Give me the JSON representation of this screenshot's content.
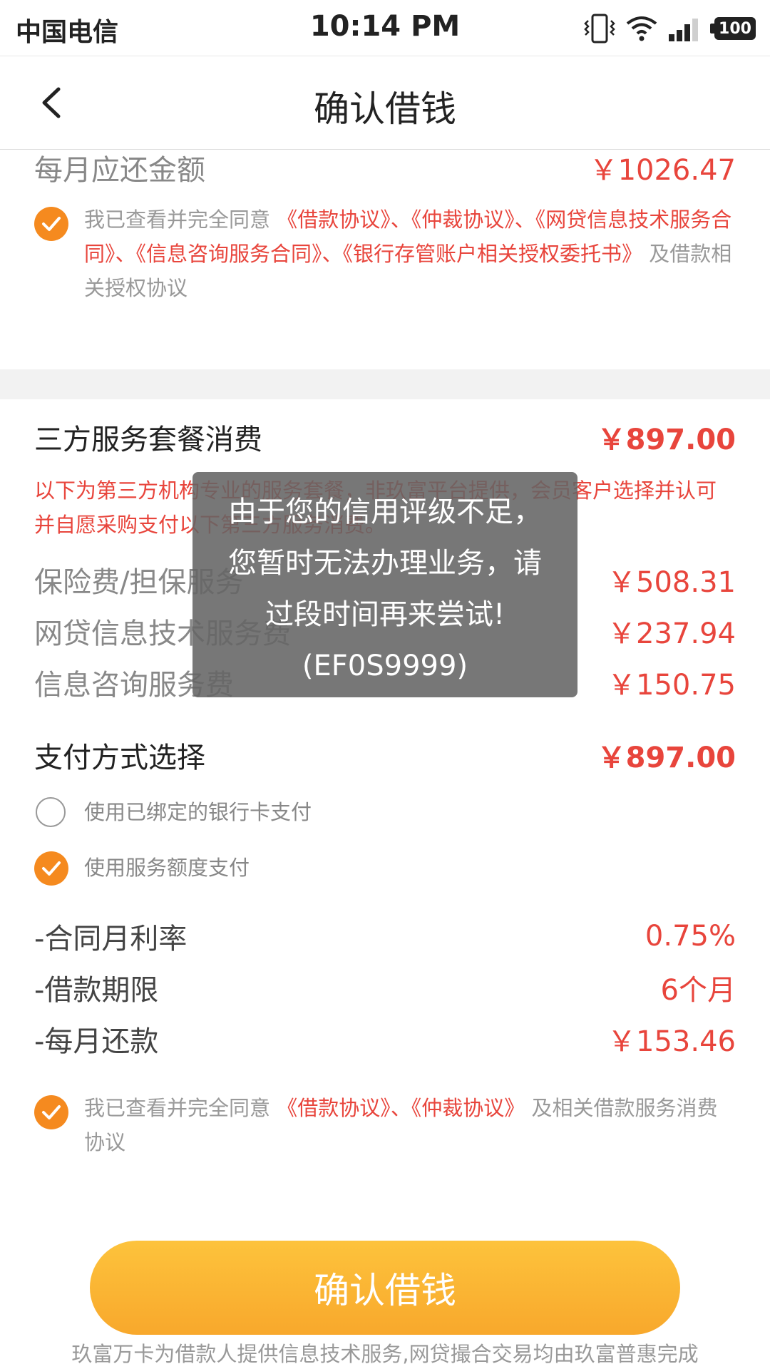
{
  "status_bar": {
    "carrier": "中国电信",
    "time": "10:14 PM",
    "battery": "100",
    "icons": [
      "vibrate-icon",
      "wifi-icon",
      "signal-icon",
      "battery-icon"
    ]
  },
  "nav": {
    "title": "确认借钱",
    "back_icon": "chevron-left-icon"
  },
  "monthly": {
    "label": "每月应还金额",
    "value": "￥1026.47"
  },
  "agreement1": {
    "checked": true,
    "prefix": "我已查看并完全同意 ",
    "links": "《借款协议》、《仲裁协议》、《网贷信息技术服务合同》、《信息咨询服务合同》、《银行存管账户相关授权委托书》",
    "suffix": " 及借款相关授权协议"
  },
  "third_party": {
    "title": "三方服务套餐消费",
    "total": "￥897.00",
    "notice": "以下为第三方机构专业的服务套餐，非玖富平台提供，会员客户选择并认可 并自愿采购支付以下第三方服务消费。",
    "items": [
      {
        "label": "保险费/担保服务",
        "value": "￥508.31"
      },
      {
        "label": "网贷信息技术服务费",
        "value": "￥237.94"
      },
      {
        "label": "信息咨询服务费",
        "value": "￥150.75"
      }
    ]
  },
  "payment": {
    "title": "支付方式选择",
    "total": "￥897.00",
    "options": [
      {
        "label": "使用已绑定的银行卡支付",
        "selected": false
      },
      {
        "label": "使用服务额度支付",
        "selected": true
      }
    ]
  },
  "terms": [
    {
      "label": "-合同月利率",
      "value": "0.75%"
    },
    {
      "label": "-借款期限",
      "value": "6个月"
    },
    {
      "label": "-每月还款",
      "value": "￥153.46"
    }
  ],
  "agreement2": {
    "checked": true,
    "prefix": "我已查看并完全同意 ",
    "links": "《借款协议》、《仲裁协议》",
    "suffix": " 及相关借款服务消费协议"
  },
  "confirm_button": "确认借钱",
  "footer": "玖富万卡为借款人提供信息技术服务,网贷撮合交易均由玖富普惠完成",
  "toast": "由于您的信用评级不足，您暂时无法办理业务，请过段时间再来尝试!(EF0S9999)",
  "colors": {
    "accent_orange": "#f58a1f",
    "red": "#e8453c",
    "button_yellow": "#fdb934"
  }
}
